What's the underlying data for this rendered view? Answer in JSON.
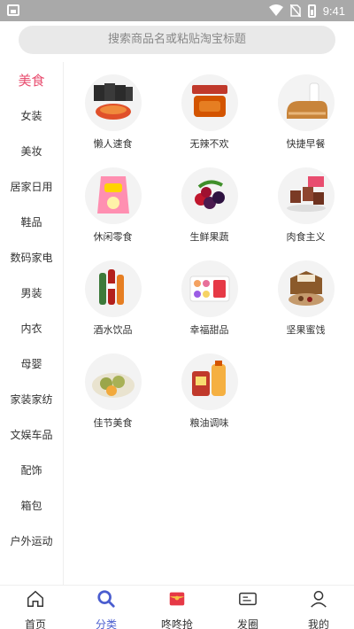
{
  "status_bar": {
    "time": "9:41"
  },
  "search": {
    "placeholder": "搜索商品名或粘贴淘宝标题"
  },
  "sidebar": {
    "active_color": "#e84d6f",
    "items": [
      {
        "label": "美食",
        "active": true
      },
      {
        "label": "女装"
      },
      {
        "label": "美妆"
      },
      {
        "label": "居家日用"
      },
      {
        "label": "鞋品"
      },
      {
        "label": "数码家电"
      },
      {
        "label": "男装"
      },
      {
        "label": "内衣"
      },
      {
        "label": "母婴"
      },
      {
        "label": "家装家纺"
      },
      {
        "label": "文娱车品"
      },
      {
        "label": "配饰"
      },
      {
        "label": "箱包"
      },
      {
        "label": "户外运动"
      }
    ]
  },
  "categories": [
    {
      "label": "懒人速食",
      "icon": "instant-noodles-icon"
    },
    {
      "label": "无辣不欢",
      "icon": "spicy-jerky-icon"
    },
    {
      "label": "快捷早餐",
      "icon": "bread-milk-icon"
    },
    {
      "label": "休闲零食",
      "icon": "chips-bag-icon"
    },
    {
      "label": "生鲜果蔬",
      "icon": "berries-icon"
    },
    {
      "label": "肉食主义",
      "icon": "meat-cubes-icon"
    },
    {
      "label": "酒水饮品",
      "icon": "bottles-icon"
    },
    {
      "label": "幸福甜品",
      "icon": "macarons-icon"
    },
    {
      "label": "坚果蜜饯",
      "icon": "nuts-box-icon"
    },
    {
      "label": "佳节美食",
      "icon": "salted-eggs-icon"
    },
    {
      "label": "粮油调味",
      "icon": "rice-oil-icon"
    }
  ],
  "bottom_nav": {
    "active_color": "#4a5dcf",
    "items": [
      {
        "label": "首页",
        "icon": "home-icon"
      },
      {
        "label": "分类",
        "icon": "search-icon",
        "active": true
      },
      {
        "label": "咚咚抢",
        "icon": "red-envelope-icon"
      },
      {
        "label": "发圈",
        "icon": "share-card-icon"
      },
      {
        "label": "我的",
        "icon": "user-icon"
      }
    ]
  }
}
